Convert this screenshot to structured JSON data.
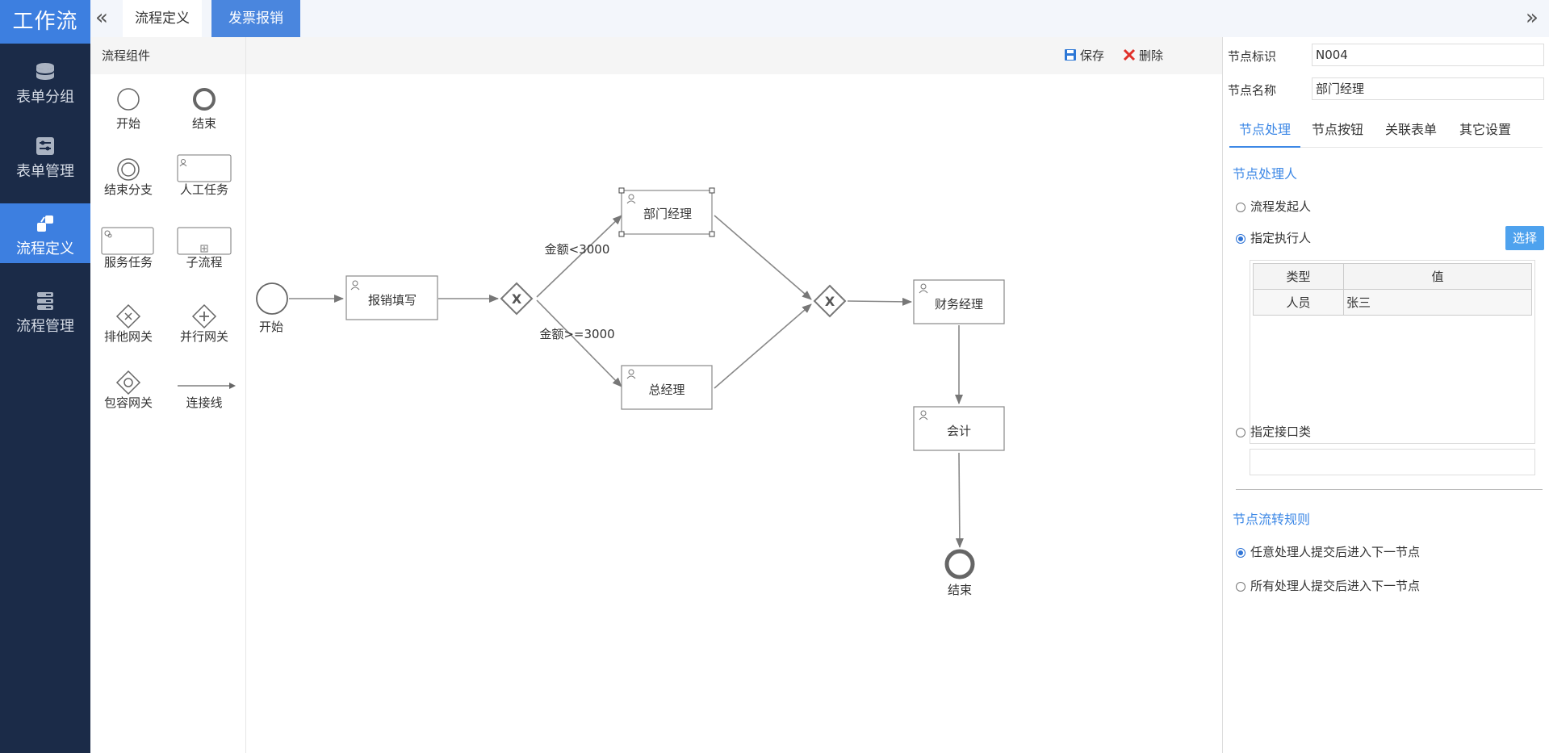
{
  "app": {
    "brand": "工作流"
  },
  "sidebar": {
    "items": [
      {
        "label": "表单分组",
        "icon": "database-icon",
        "active": false
      },
      {
        "label": "表单管理",
        "icon": "sliders-icon",
        "active": false
      },
      {
        "label": "流程定义",
        "icon": "flow-icon",
        "active": true
      },
      {
        "label": "流程管理",
        "icon": "server-icon",
        "active": false
      }
    ]
  },
  "topbar": {
    "tabs": [
      {
        "label": "流程定义",
        "active": false
      },
      {
        "label": "发票报销",
        "active": true
      }
    ],
    "collapse_left": "«",
    "collapse_right": "»"
  },
  "palette": {
    "title": "流程组件",
    "items": [
      {
        "label": "开始",
        "icon": "start-event-icon"
      },
      {
        "label": "结束",
        "icon": "end-event-icon"
      },
      {
        "label": "结束分支",
        "icon": "end-branch-icon"
      },
      {
        "label": "人工任务",
        "icon": "user-task-icon"
      },
      {
        "label": "服务任务",
        "icon": "service-task-icon"
      },
      {
        "label": "子流程",
        "icon": "subprocess-icon"
      },
      {
        "label": "排他网关",
        "icon": "exclusive-gateway-icon"
      },
      {
        "label": "并行网关",
        "icon": "parallel-gateway-icon"
      },
      {
        "label": "包容网关",
        "icon": "inclusive-gateway-icon"
      },
      {
        "label": "连接线",
        "icon": "connector-icon"
      }
    ]
  },
  "toolbar": {
    "save_label": "保存",
    "delete_label": "删除"
  },
  "diagram": {
    "start_label": "开始",
    "end_label": "结束",
    "tasks": {
      "fill": "报销填写",
      "dept": "部门经理",
      "gm": "总经理",
      "finance": "财务经理",
      "accountant": "会计"
    },
    "conditions": {
      "lt": "金额<3000",
      "gte": "金额>=3000"
    },
    "gateway_mark": "X"
  },
  "props": {
    "node_id_label": "节点标识",
    "node_id_value": "N004",
    "node_name_label": "节点名称",
    "node_name_value": "部门经理",
    "tabs": [
      "节点处理",
      "节点按钮",
      "关联表单",
      "其它设置"
    ],
    "section_handler": "节点处理人",
    "opt_initiator": "流程发起人",
    "opt_assignee": "指定执行人",
    "choose_button": "选择",
    "grid_headers": [
      "类型",
      "值"
    ],
    "grid_rows": [
      [
        "人员",
        "张三"
      ]
    ],
    "opt_interface": "指定接口类",
    "section_rule": "节点流转规则",
    "rule_any": "任意处理人提交后进入下一节点",
    "rule_all": "所有处理人提交后进入下一节点"
  },
  "colors": {
    "sidebar_bg": "#1b2b48",
    "accent": "#3d7fe0",
    "link_blue": "#3d88e6"
  }
}
